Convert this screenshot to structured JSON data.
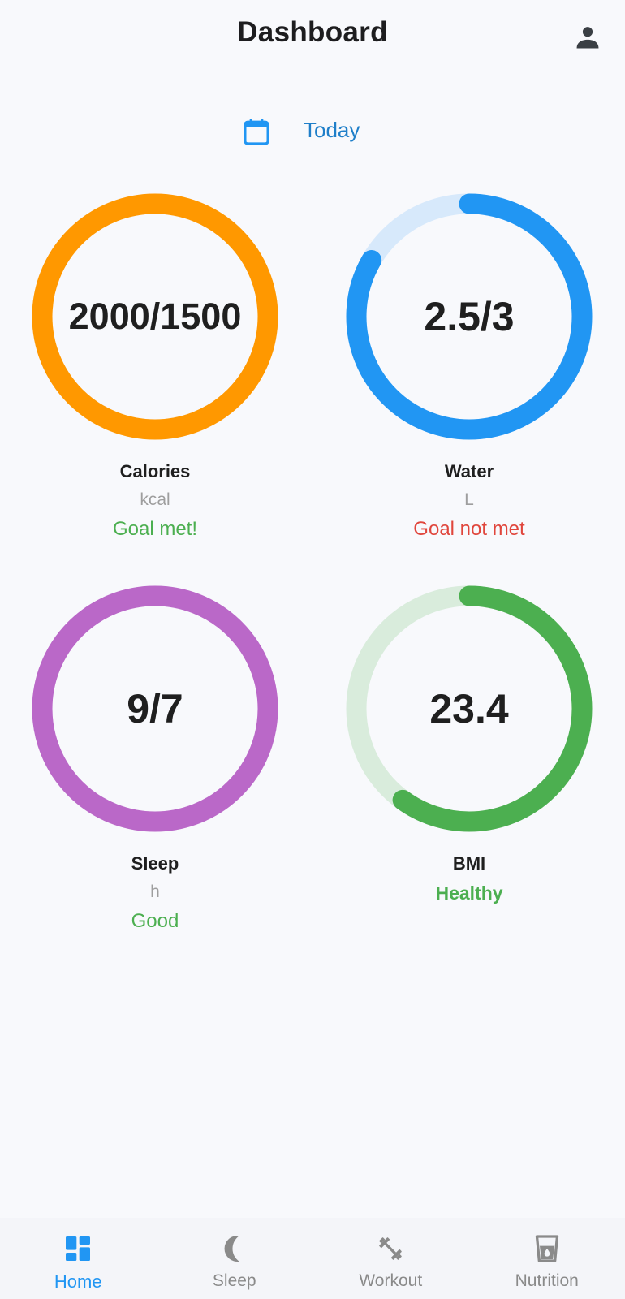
{
  "header": {
    "title": "Dashboard",
    "profile_icon": "person-icon"
  },
  "date": {
    "icon": "calendar-icon",
    "label": "Today"
  },
  "metrics": [
    {
      "label": "Calories",
      "value": "2000/1500",
      "unit": "kcal",
      "status": "Goal met!",
      "status_color": "#4caf50",
      "ring_color": "#ff9800",
      "track_color": "#ffe0b2",
      "progress": 1.0
    },
    {
      "label": "Water",
      "value": "2.5/3",
      "unit": "L",
      "status": "Goal not met",
      "status_color": "#e0463c",
      "ring_color": "#2196f3",
      "track_color": "#d7e9fb",
      "progress": 0.833
    },
    {
      "label": "Sleep",
      "value": "9/7",
      "unit": "h",
      "status": "Good",
      "status_color": "#4caf50",
      "ring_color": "#ba68c8",
      "track_color": "#ead3f0",
      "progress": 1.0
    },
    {
      "label": "BMI",
      "value": "23.4",
      "status": "Healthy",
      "status_color": "#4caf50",
      "ring_color": "#4caf50",
      "track_color": "#d9ecdc",
      "progress": 0.6
    }
  ],
  "nav": {
    "active_color": "#2196f3",
    "inactive_color": "#8a8a8a",
    "items": [
      {
        "label": "Home",
        "icon": "dashboard-icon",
        "active": true
      },
      {
        "label": "Sleep",
        "icon": "moon-icon",
        "active": false
      },
      {
        "label": "Workout",
        "icon": "dumbbell-icon",
        "active": false
      },
      {
        "label": "Nutrition",
        "icon": "glass-icon",
        "active": false
      }
    ]
  }
}
